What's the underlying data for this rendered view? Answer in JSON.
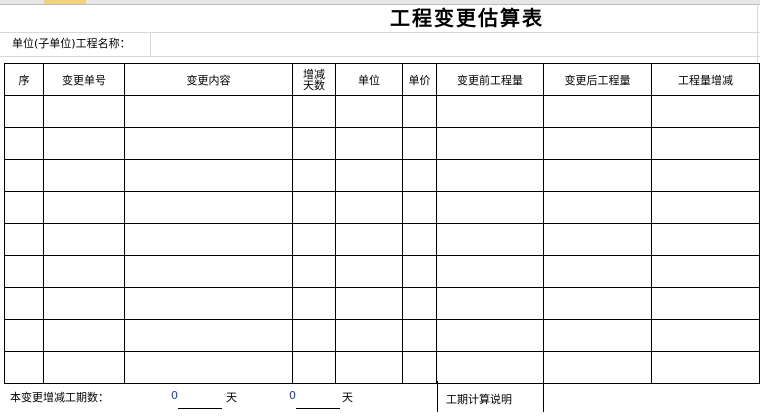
{
  "title": "工程变更估算表",
  "unit_label": "单位(子单位)工程名称：",
  "table": {
    "headers": {
      "seq": "序",
      "change_no": "变更单号",
      "content": "变更内容",
      "days_line1": "增减",
      "days_line2": "天数",
      "unit": "单位",
      "price": "单价",
      "before": "变更前工程量",
      "after": "变更后工程量",
      "delta": "工程量增减"
    },
    "empty_rows": 9
  },
  "footer": {
    "label": "本变更增减工期数：",
    "value1": "0",
    "unit1": "天",
    "value2": "0",
    "unit2": "天",
    "note": "工期计算说明"
  }
}
